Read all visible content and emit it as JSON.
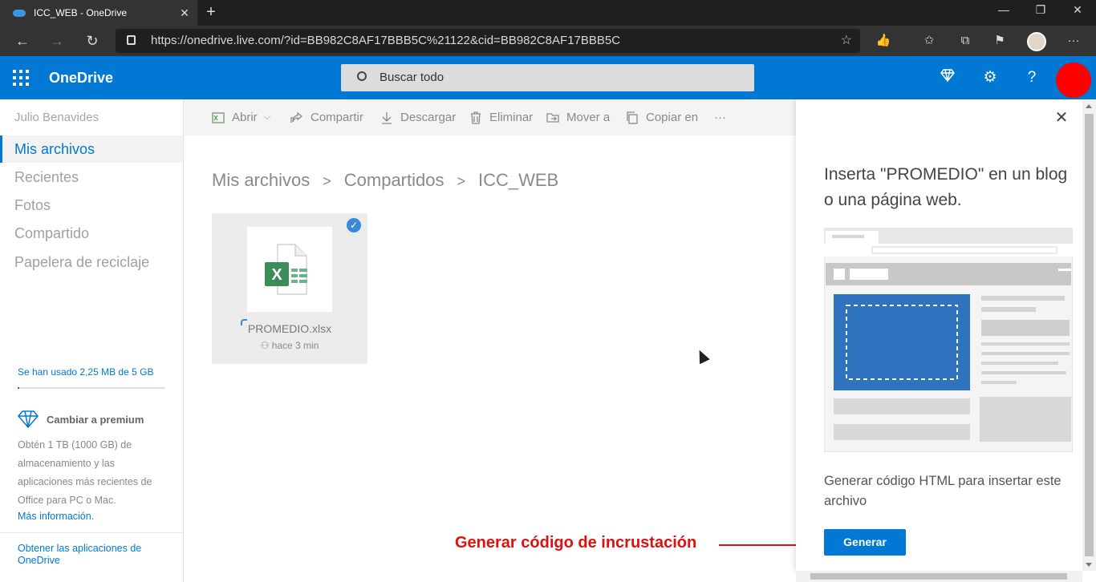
{
  "browser": {
    "tab_title": "ICC_WEB - OneDrive",
    "url": "https://onedrive.live.com/?id=BB982C8AF17BBB5C%21122&cid=BB982C8AF17BBB5C"
  },
  "header": {
    "brand": "OneDrive",
    "search_placeholder": "Buscar todo",
    "help_glyph": "?"
  },
  "sidebar": {
    "user_name": "Julio Benavides",
    "items": [
      {
        "label": "Mis archivos"
      },
      {
        "label": "Recientes"
      },
      {
        "label": "Fotos"
      },
      {
        "label": "Compartido"
      },
      {
        "label": "Papelera de reciclaje"
      }
    ],
    "storage_text": "Se han usado 2,25 MB de 5 GB",
    "storage_fraction": 0.00045,
    "premium_title": "Cambiar a premium",
    "premium_body": "Obtén 1 TB (1000 GB) de almacenamiento y las aplicaciones más recientes de Office para PC o Mac.",
    "premium_link": "Más información.",
    "apps_link": "Obtener las aplicaciones de OneDrive"
  },
  "commands": {
    "open": "Abrir",
    "share": "Compartir",
    "download": "Descargar",
    "delete": "Eliminar",
    "move": "Mover a",
    "copy": "Copiar en",
    "more": "···"
  },
  "breadcrumb": {
    "items": [
      "Mis archivos",
      "Compartidos",
      "ICC_WEB"
    ],
    "separator": ">"
  },
  "file": {
    "name": "PROMEDIO.xlsx",
    "meta": "hace 3 min",
    "badge": "X"
  },
  "panel": {
    "title": "Inserta \"PROMEDIO\" en un blog o una página web.",
    "description": "Generar código HTML para insertar este archivo",
    "button": "Generar"
  },
  "annotation": {
    "text": "Generar código de incrustación",
    "color": "#e01010"
  },
  "colors": {
    "accent": "#0078d4",
    "excel_green": "#217346"
  }
}
